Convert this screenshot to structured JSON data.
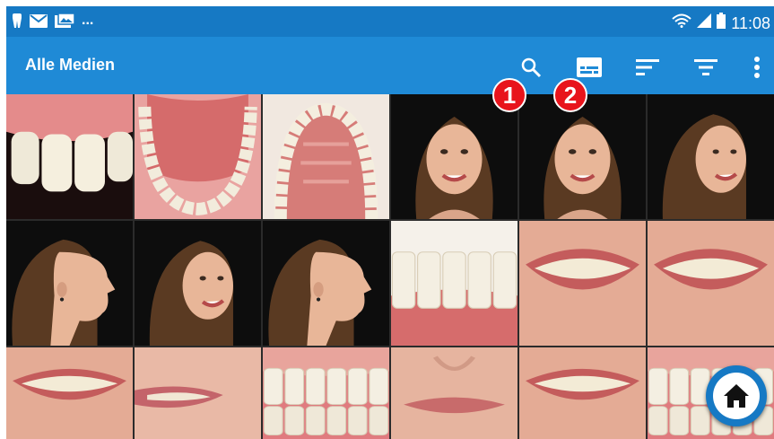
{
  "status_bar": {
    "time": "11:08",
    "overflow": "...",
    "icons_left": [
      "tooth-icon",
      "mail-icon",
      "photo-icon"
    ],
    "icons_right": [
      "wifi-icon",
      "signal-icon",
      "battery-icon"
    ]
  },
  "app_bar": {
    "title": "Alle Medien",
    "actions": [
      "search-icon",
      "subtitles-icon",
      "sort-icon",
      "filter-icon",
      "more-icon"
    ]
  },
  "callouts": [
    "1",
    "2"
  ],
  "gallery": {
    "rows": [
      [
        "teeth-front",
        "lower-arch",
        "upper-arch",
        "face-frontal",
        "face-frontal",
        "face-three-quarter"
      ],
      [
        "face-profile",
        "face-three-quarter",
        "face-profile",
        "teeth-lower-close",
        "lips-smile",
        "lips-smile"
      ],
      [
        "lips-smile",
        "lips-profile",
        "teeth-front-smile",
        "lips-relaxed",
        "lips-smile",
        "teeth-front-smile"
      ]
    ]
  },
  "fab": {
    "icon": "home-icon"
  },
  "colors": {
    "status_bar": "#1679c4",
    "app_bar": "#1f8ad6",
    "callout": "#e8141c"
  }
}
